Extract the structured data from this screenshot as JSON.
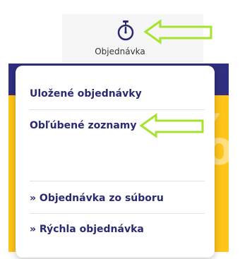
{
  "header": {
    "tab_label": "Objednávka",
    "icon": "stopwatch-icon"
  },
  "menu": {
    "items": [
      {
        "label": "Uložené objednávky"
      },
      {
        "label": "Obľúbené zoznamy"
      },
      {
        "label": "» Objednávka zo súboru"
      },
      {
        "label": "» Rýchla objednávka"
      }
    ]
  },
  "annotations": {
    "arrow_color": "#a6e22e",
    "arrow_icon": "left-arrow-icon"
  },
  "colors": {
    "navy": "#2f2f7f",
    "yellow": "#ffc51a",
    "menu_text": "#2a2a72"
  }
}
